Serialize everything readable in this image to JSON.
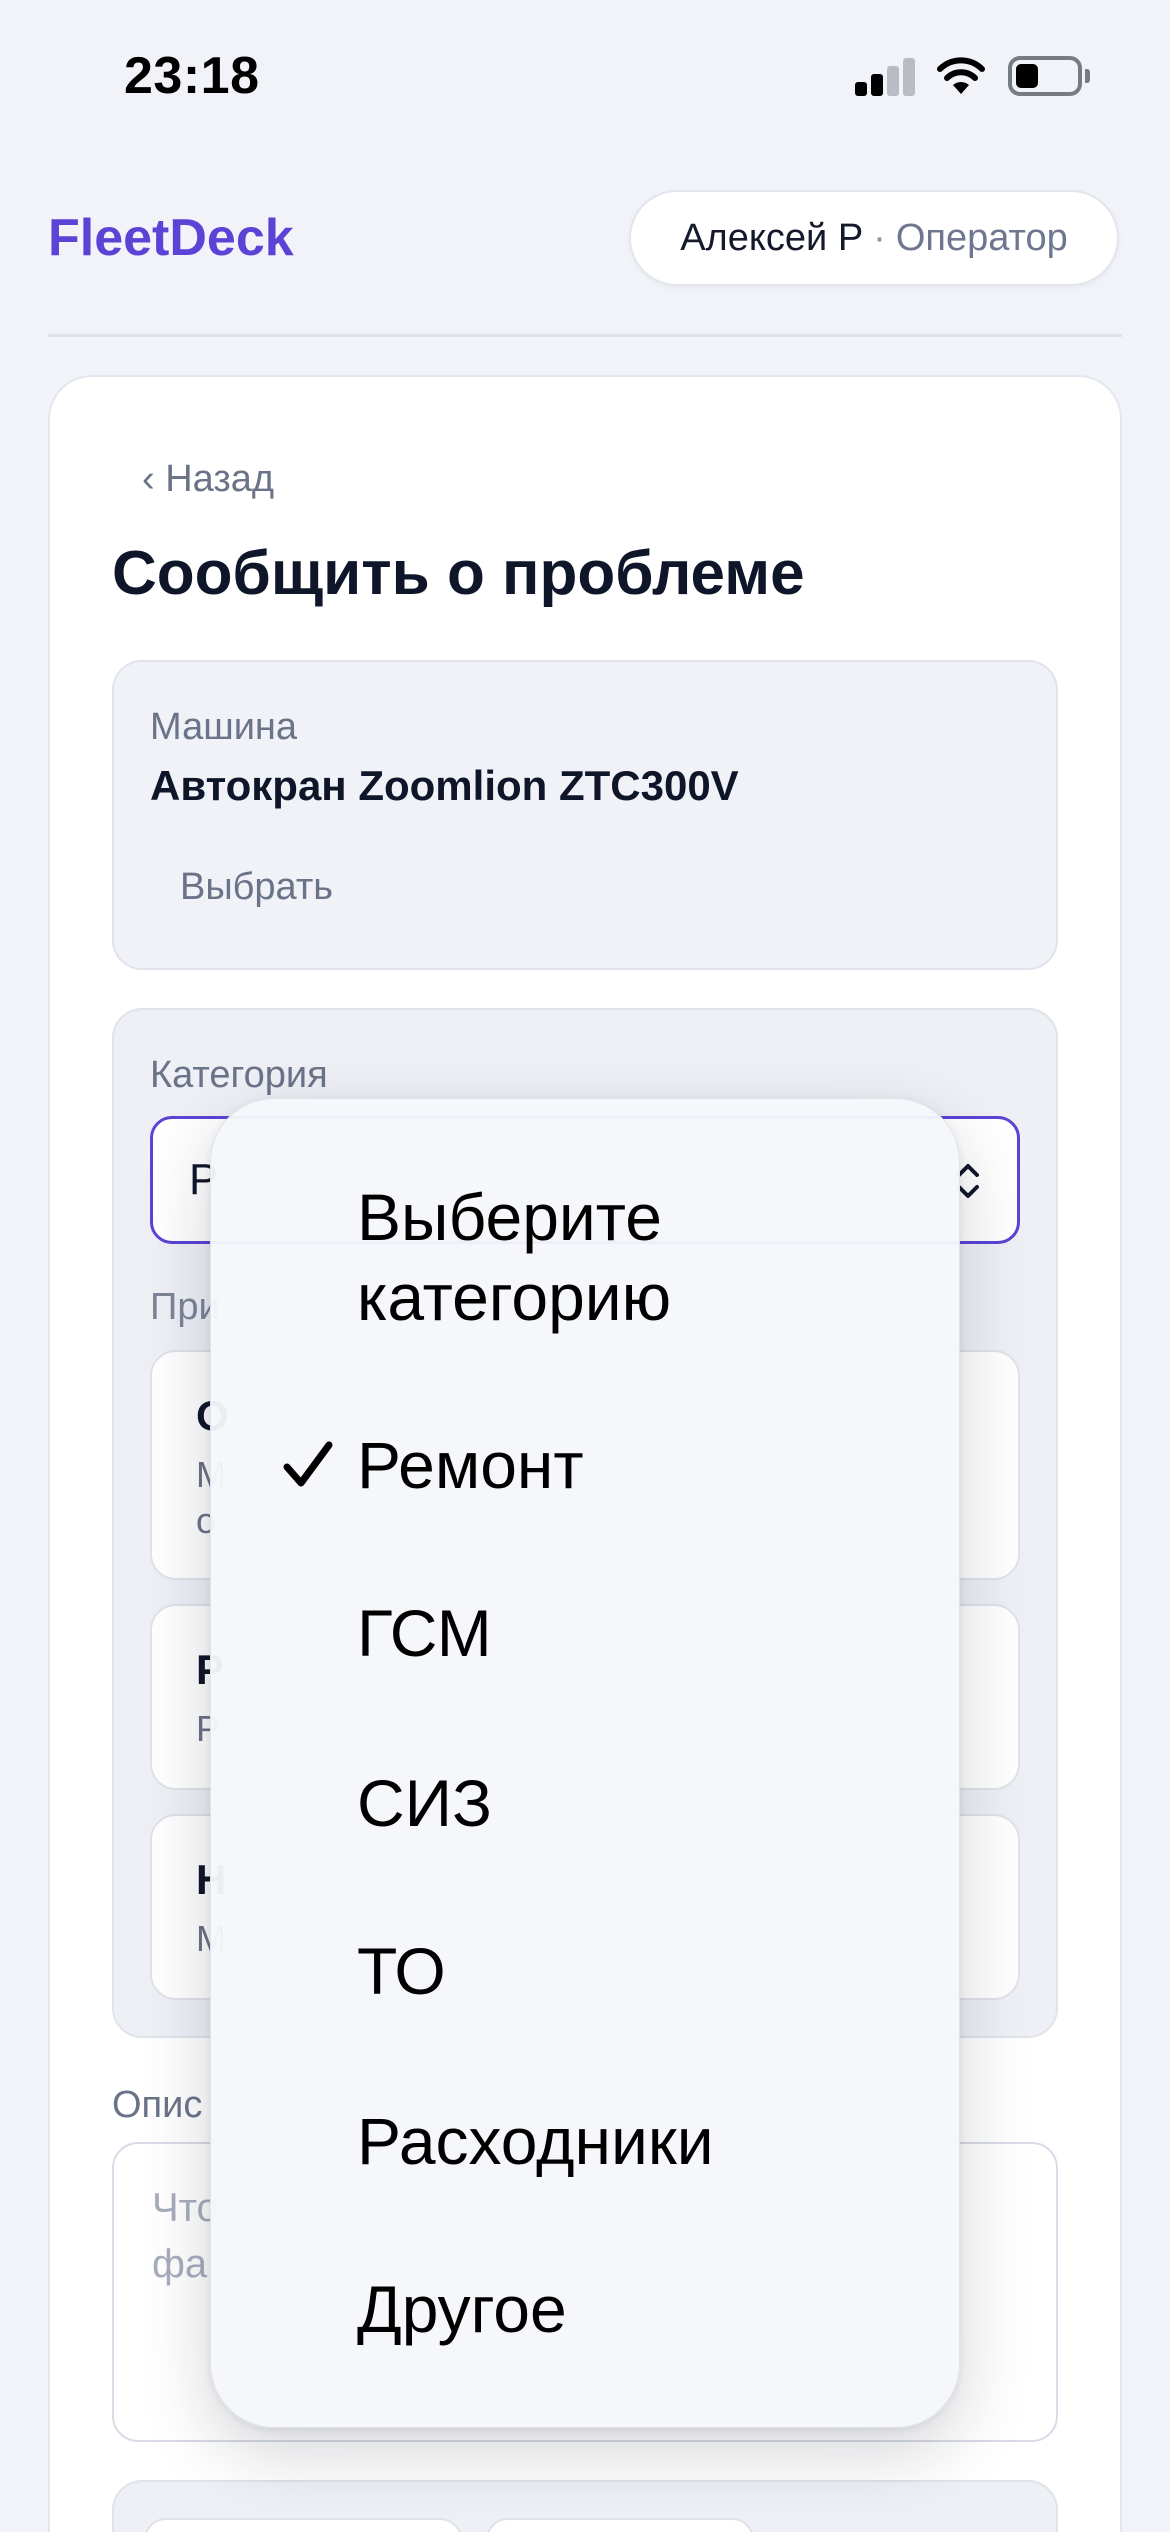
{
  "status_bar": {
    "time": "23:18"
  },
  "header": {
    "logo": "FleetDeck",
    "user_name": "Алексей Р",
    "separator": "·",
    "user_role": "Оператор"
  },
  "page": {
    "back_label": "‹ Назад",
    "title": "Сообщить о проблеме"
  },
  "machine": {
    "label": "Машина",
    "name": "Автокран Zoomlion ZTC300V",
    "select_label": "Выбрать"
  },
  "category": {
    "label": "Категория",
    "selected_value": "Р",
    "reasons_label": "При"
  },
  "reasons": [
    {
      "title": "О",
      "subtitle": "М\nо"
    },
    {
      "title": "Р",
      "subtitle": "Р"
    },
    {
      "title": "Н",
      "subtitle": "М"
    }
  ],
  "description": {
    "label": "Опис",
    "placeholder": "Что\nфа"
  },
  "dropdown": {
    "options": [
      {
        "label": "Выберите категорию",
        "selected": false
      },
      {
        "label": "Ремонт",
        "selected": true
      },
      {
        "label": "ГСМ",
        "selected": false
      },
      {
        "label": "СИЗ",
        "selected": false
      },
      {
        "label": "ТО",
        "selected": false
      },
      {
        "label": "Расходники",
        "selected": false
      },
      {
        "label": "Другое",
        "selected": false
      }
    ]
  },
  "colors": {
    "accent": "#5b43d6",
    "background": "#f1f3f8",
    "muted_text": "#6b7388"
  }
}
